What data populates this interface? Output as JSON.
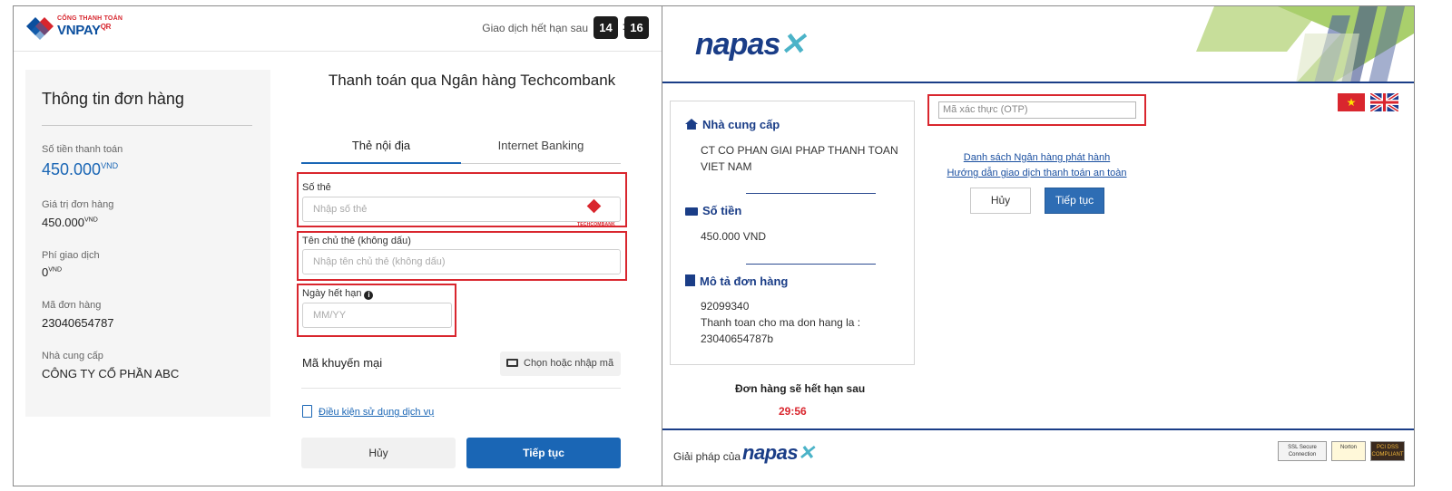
{
  "vnpay": {
    "logo_tag": "CỔNG THANH TOÁN",
    "logo_word": "VNPAY",
    "logo_qr": "QR",
    "expiry_label": "Giao dịch hết hạn sau",
    "timer_minutes": "14",
    "timer_colon": ":",
    "timer_seconds": "16",
    "order": {
      "title": "Thông tin đơn hàng",
      "amount_label": "Số tiền thanh toán",
      "amount_value": "450.000",
      "amount_unit": "VND",
      "order_value_label": "Giá trị đơn hàng",
      "order_value": "450.000",
      "order_value_unit": "VND",
      "fee_label": "Phí giao dịch",
      "fee_value": "0",
      "fee_unit": "VND",
      "order_id_label": "Mã đơn hàng",
      "order_id": "23040654787",
      "provider_label": "Nhà cung cấp",
      "provider": "CÔNG TY CỔ PHẦN ABC"
    },
    "pay_title": "Thanh toán qua Ngân hàng Techcombank",
    "tabs": [
      {
        "label": "Thẻ nội địa",
        "active": true
      },
      {
        "label": "Internet Banking",
        "active": false
      }
    ],
    "form": {
      "card_number_label": "Số thẻ",
      "card_number_placeholder": "Nhập số thẻ",
      "bank_logo_text": "TECHCOMBANK",
      "holder_label": "Tên chủ thẻ (không dấu)",
      "holder_placeholder": "Nhập tên chủ thẻ (không dấu)",
      "expiry_label": "Ngày hết hạn",
      "expiry_info_icon": "i",
      "expiry_placeholder": "MM/YY"
    },
    "promo_label": "Mã khuyến mại",
    "promo_button": "Chọn hoặc nhập mã",
    "terms_link": "Điều kiện sử dụng dịch vụ",
    "cancel_button": "Hủy",
    "continue_button": "Tiếp tục",
    "colors": {
      "accent": "#1a66b5",
      "highlight": "#d9262e"
    }
  },
  "napas": {
    "logo": "napas",
    "logo_mark": "✕",
    "provider_title": "Nhà cung cấp",
    "provider_text": "CT CO PHAN GIAI PHAP THANH TOAN VIET NAM",
    "amount_title": "Số tiền",
    "amount_text": "450.000 VND",
    "desc_title": "Mô tả đơn hàng",
    "desc_id": "92099340",
    "desc_text": "Thanh toan cho ma don hang la : 23040654787b",
    "expire_label": "Đơn hàng sẽ hết hạn sau",
    "expire_time": "29:56",
    "otp_placeholder": "Mã xác thực (OTP)",
    "flag_vn_star": "★",
    "link_banks": "Danh sách Ngân hàng phát hành",
    "link_guide": "Hướng dẫn giao dịch thanh toán an toàn",
    "cancel_button": "Hủy",
    "continue_button": "Tiếp tục",
    "footer_text": "Giải pháp của",
    "footer_logo": "napas",
    "badges": {
      "ssl": "SSL Secure Connection",
      "norton": "Norton",
      "pci": "PCI DSS COMPLIANT"
    },
    "colors": {
      "brand": "#1a3d87",
      "button": "#2e6db4",
      "highlight": "#d9262e"
    }
  }
}
